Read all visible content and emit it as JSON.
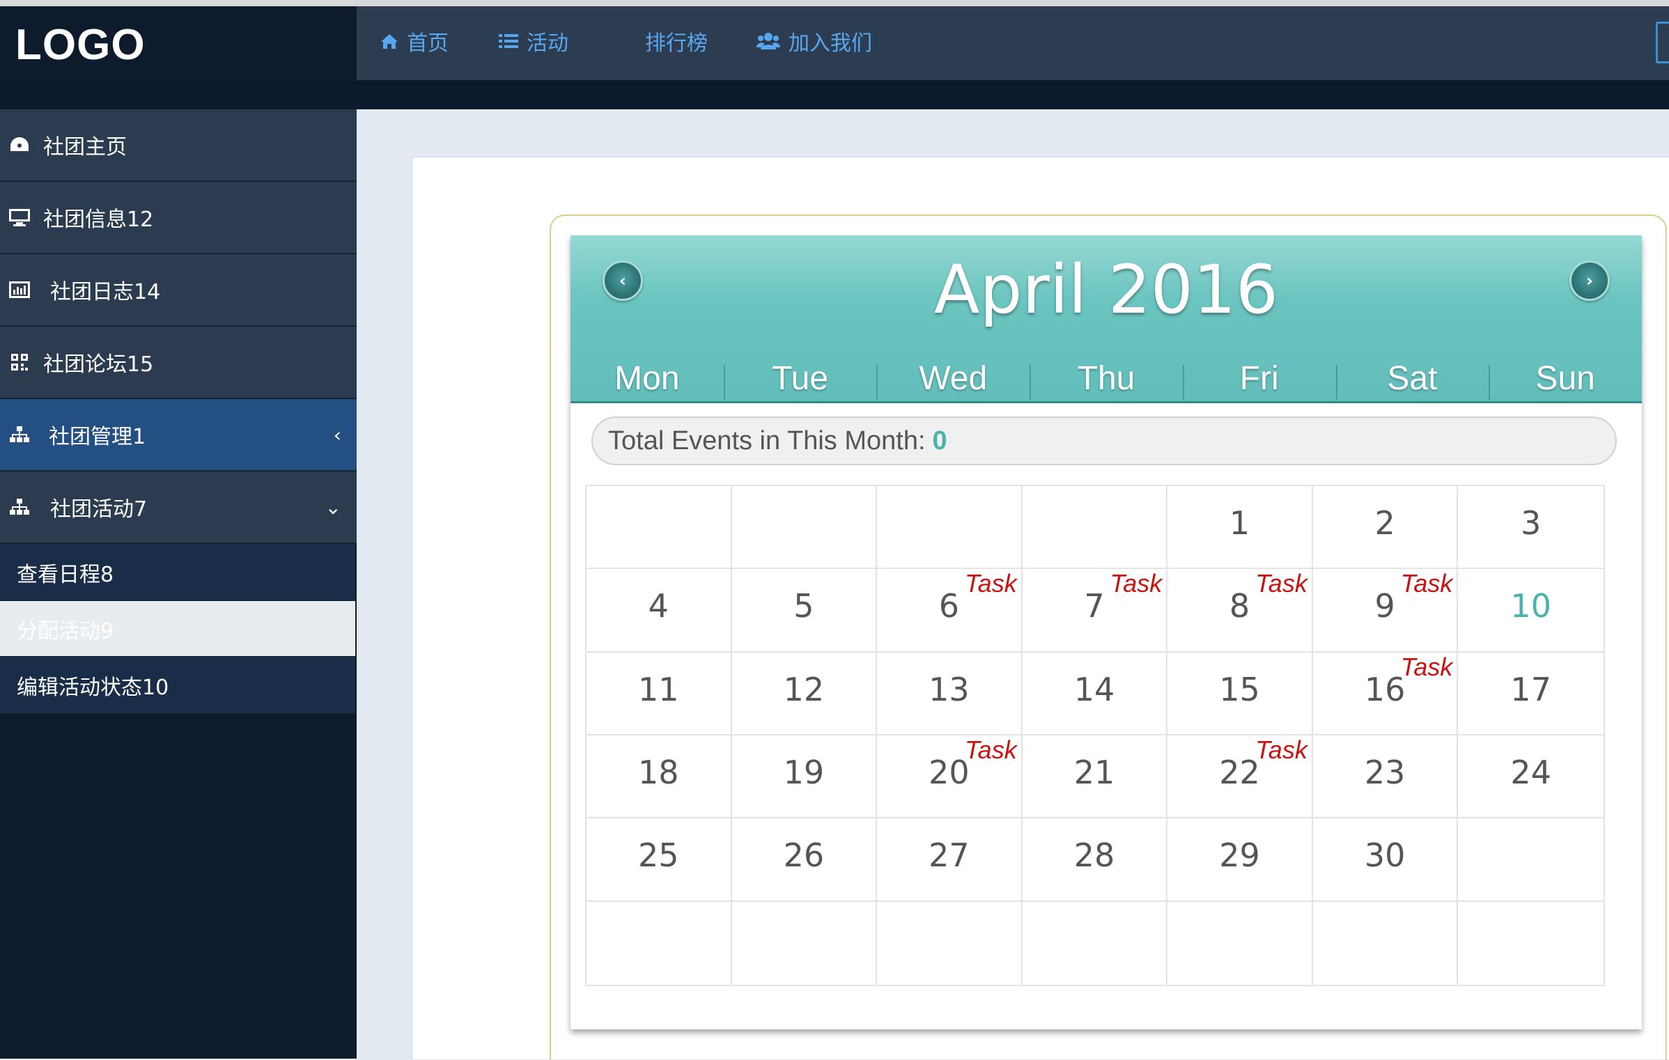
{
  "logo": "LOGO",
  "topnav": [
    {
      "label": "首页",
      "icon": "home-icon"
    },
    {
      "label": "活动",
      "icon": "list-icon"
    },
    {
      "label": "排行榜",
      "icon": ""
    },
    {
      "label": "加入我们",
      "icon": "users-icon"
    }
  ],
  "sidebar": {
    "items": [
      {
        "label": "社团主页",
        "icon": "dashboard-icon",
        "chevron": ""
      },
      {
        "label": "社团信息12",
        "icon": "monitor-icon",
        "chevron": ""
      },
      {
        "label": "社团日志14",
        "icon": "bar-chart-icon",
        "chevron": ""
      },
      {
        "label": "社团论坛15",
        "icon": "qrcode-icon",
        "chevron": ""
      },
      {
        "label": "社团管理1",
        "icon": "sitemap-icon",
        "chevron": "‹"
      },
      {
        "label": "社团活动7",
        "icon": "sitemap-icon",
        "chevron": "⌄"
      }
    ],
    "subitems": [
      {
        "label": "查看日程8"
      },
      {
        "label": "分配活动9"
      },
      {
        "label": "编辑活动状态10"
      }
    ]
  },
  "calendar": {
    "month_title": "April 2016",
    "prev_label": "‹",
    "next_label": "›",
    "weekdays": [
      "Mon",
      "Tue",
      "Wed",
      "Thu",
      "Fri",
      "Sat",
      "Sun"
    ],
    "summary_label": "Total Events in This Month:",
    "summary_count": "0",
    "task_label": "Task",
    "today": 10,
    "first_weekday_index": 4,
    "days_in_month": 30,
    "task_days": [
      6,
      7,
      8,
      9,
      16,
      20,
      22
    ],
    "weeks": 6
  },
  "colors": {
    "accent_teal": "#4bb3ad",
    "task_red": "#cc1111",
    "nav_blue": "#58a8f0"
  }
}
